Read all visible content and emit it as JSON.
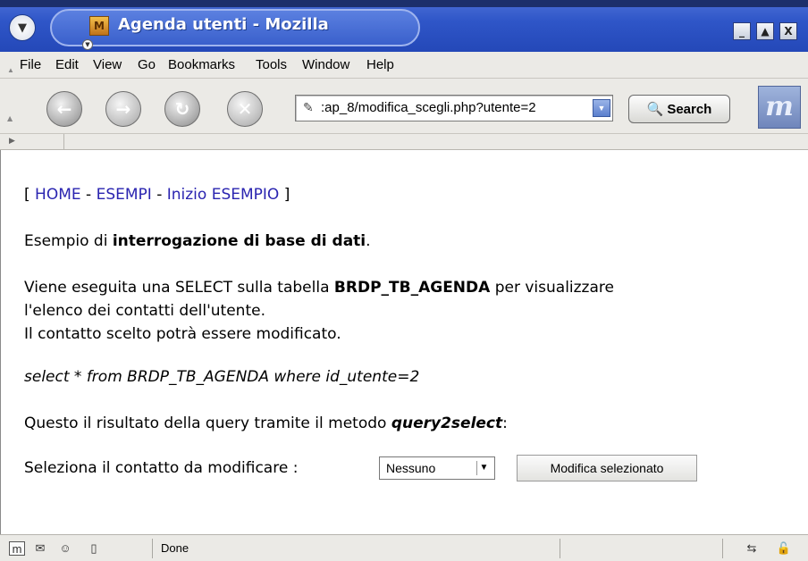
{
  "window": {
    "title": "Agenda utenti - Mozilla",
    "buttons": {
      "minimize": "_",
      "maximize": "▲",
      "close": "X"
    }
  },
  "menu": [
    {
      "label": "File"
    },
    {
      "label": "Edit"
    },
    {
      "label": "View"
    },
    {
      "label": "Go"
    },
    {
      "label": "Bookmarks"
    },
    {
      "label": "Tools"
    },
    {
      "label": "Window"
    },
    {
      "label": "Help"
    }
  ],
  "toolbar": {
    "url": ":ap_8/modifica_scegli.php?utente=2",
    "search_label": "Search"
  },
  "content": {
    "nav": {
      "open": "[ ",
      "home": "HOME",
      "sep1": " - ",
      "esempi": "ESEMPI",
      "sep2": " - ",
      "inizio": "Inizio ESEMPIO",
      "close": " ]"
    },
    "intro": {
      "pre": "Esempio di ",
      "bold": "interrogazione di base di dati",
      "post": "."
    },
    "desc1": {
      "pre": "Viene eseguita una SELECT sulla tabella ",
      "bold": "BRDP_TB_AGENDA",
      "post": " per visualizzare"
    },
    "desc2": "l'elenco dei contatti dell'utente.",
    "desc3": "Il contatto scelto potrà essere modificato.",
    "query": "select * from BRDP_TB_AGENDA where id_utente=2",
    "result": {
      "pre": "Questo il risultato della query tramite il metodo ",
      "bold": "query2select",
      "post": ":"
    },
    "select_label": "Seleziona il contatto da modificare :",
    "select_value": "Nessuno",
    "modify_button": "Modifica selezionato"
  },
  "status": {
    "text": "Done"
  }
}
